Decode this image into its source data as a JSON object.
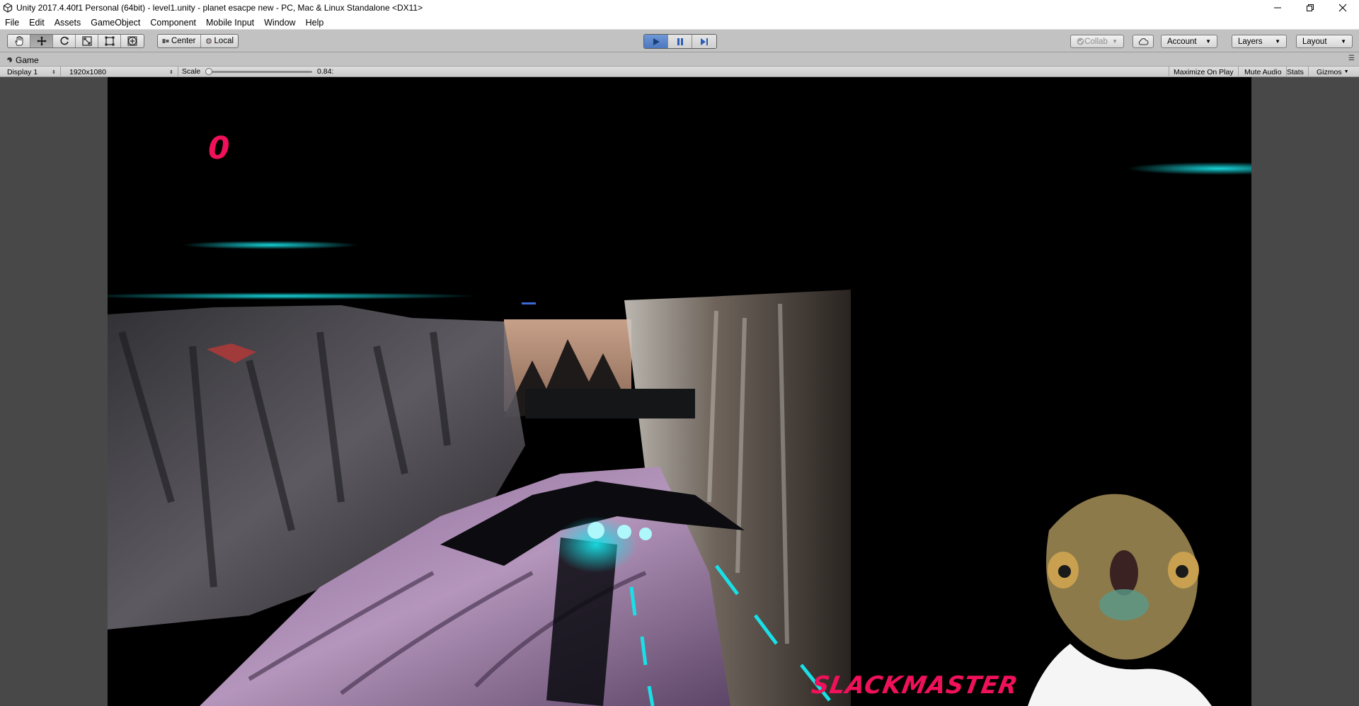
{
  "window": {
    "title": "Unity 2017.4.40f1 Personal (64bit) - level1.unity - planet esacpe new - PC, Mac & Linux Standalone <DX11>",
    "controls": [
      "minimize-icon",
      "restore-icon",
      "close-icon"
    ]
  },
  "menu": {
    "items": [
      "File",
      "Edit",
      "Assets",
      "GameObject",
      "Component",
      "Mobile Input",
      "Window",
      "Help"
    ]
  },
  "toolbar": {
    "transform_tools": [
      "hand-icon",
      "move-icon",
      "rotate-icon",
      "scale-icon",
      "rect-icon",
      "transform-icon"
    ],
    "active_tool": "move-icon",
    "pivot_label": "Center",
    "space_label": "Local",
    "play_state": "playing",
    "collab_label": "Collab",
    "account_label": "Account",
    "layers_label": "Layers",
    "layout_label": "Layout"
  },
  "game_tab": {
    "label": "Game",
    "display": "Display 1",
    "resolution": "1920x1080",
    "scale_label": "Scale",
    "scale_value": "0.84:",
    "scale_level": 0.02,
    "maximize_on_play": "Maximize On Play",
    "mute_audio": "Mute Audio",
    "stats": "Stats",
    "gizmos": "Gizmos"
  },
  "game_view": {
    "score": "0",
    "watermark": "SLACKMASTER",
    "colors": {
      "score": "#f0115a",
      "glow": "#19e0e6",
      "rock": "#6a5a70"
    }
  }
}
